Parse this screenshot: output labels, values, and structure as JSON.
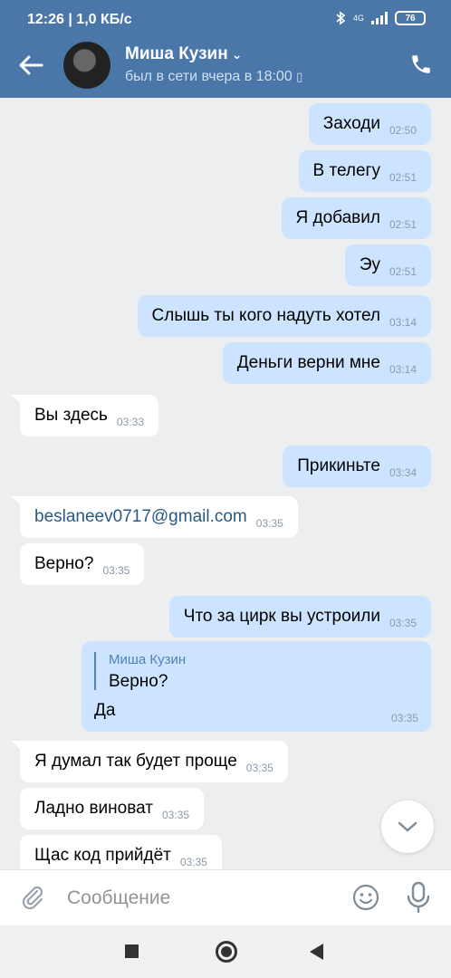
{
  "status": {
    "time": "12:26",
    "speed": "1,0 КБ/с",
    "network": "4G",
    "battery": "76"
  },
  "header": {
    "name": "Миша Кузин",
    "last_seen": "был в сети вчера в 18:00"
  },
  "messages": [
    {
      "dir": "out",
      "text": "Заходи",
      "time": "02:50"
    },
    {
      "dir": "out",
      "text": "В телегу",
      "time": "02:51"
    },
    {
      "dir": "out",
      "text": "Я добавил",
      "time": "02:51"
    },
    {
      "dir": "out",
      "text": "Эу",
      "time": "02:51"
    },
    {
      "dir": "out",
      "text": "Слышь ты кого надуть хотел",
      "time": "03:14"
    },
    {
      "dir": "out",
      "text": "Деньги верни мне",
      "time": "03:14"
    },
    {
      "dir": "in",
      "text": "Вы здесь",
      "time": "03:33"
    },
    {
      "dir": "out",
      "text": "Прикиньте",
      "time": "03:34"
    },
    {
      "dir": "in",
      "text": "beslaneev0717@gmail.com",
      "time": "03:35"
    },
    {
      "dir": "in",
      "text": "Верно?",
      "time": "03:35"
    },
    {
      "dir": "out",
      "text": "Что за цирк вы устроили",
      "time": "03:35"
    },
    {
      "dir": "in",
      "text": "Я думал так будет проще",
      "time": "03:35"
    },
    {
      "dir": "in",
      "text": "Ладно виноват",
      "time": "03:35"
    },
    {
      "dir": "in",
      "text": "Щас код прийдёт",
      "time": "03:35"
    }
  ],
  "reply_message": {
    "quoted_name": "Миша Кузин",
    "quoted_text": "Верно?",
    "text": "Да",
    "time": "03:35"
  },
  "composer": {
    "placeholder": "Сообщение"
  }
}
